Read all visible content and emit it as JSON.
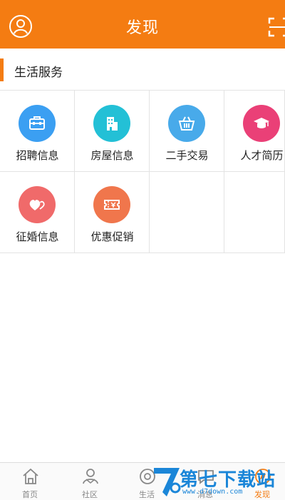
{
  "header": {
    "title": "发现"
  },
  "section": {
    "title": "生活服务"
  },
  "services": [
    {
      "label": "招聘信息",
      "icon": "briefcase-icon",
      "color": "#3b9ff2"
    },
    {
      "label": "房屋信息",
      "icon": "building-icon",
      "color": "#23c0d6"
    },
    {
      "label": "二手交易",
      "icon": "basket-icon",
      "color": "#48aaea"
    },
    {
      "label": "人才简历",
      "icon": "graduation-cap-icon",
      "color": "#ea4077"
    },
    {
      "label": "征婚信息",
      "icon": "hearts-icon",
      "color": "#f06a6a"
    },
    {
      "label": "优惠促销",
      "icon": "coupon-icon",
      "color": "#f0764c"
    }
  ],
  "tabbar": {
    "items": [
      {
        "label": "首页",
        "icon": "home-icon"
      },
      {
        "label": "社区",
        "icon": "community-icon"
      },
      {
        "label": "生活",
        "icon": "life-icon"
      },
      {
        "label": "消息",
        "icon": "message-icon"
      },
      {
        "label": "发现",
        "icon": "discover-icon"
      }
    ],
    "active_index": 4
  },
  "colors": {
    "accent": "#f47c12",
    "watermark": "#1b86d8"
  },
  "watermark": {
    "text": "第七下载站",
    "url": "www.d7down.com"
  }
}
